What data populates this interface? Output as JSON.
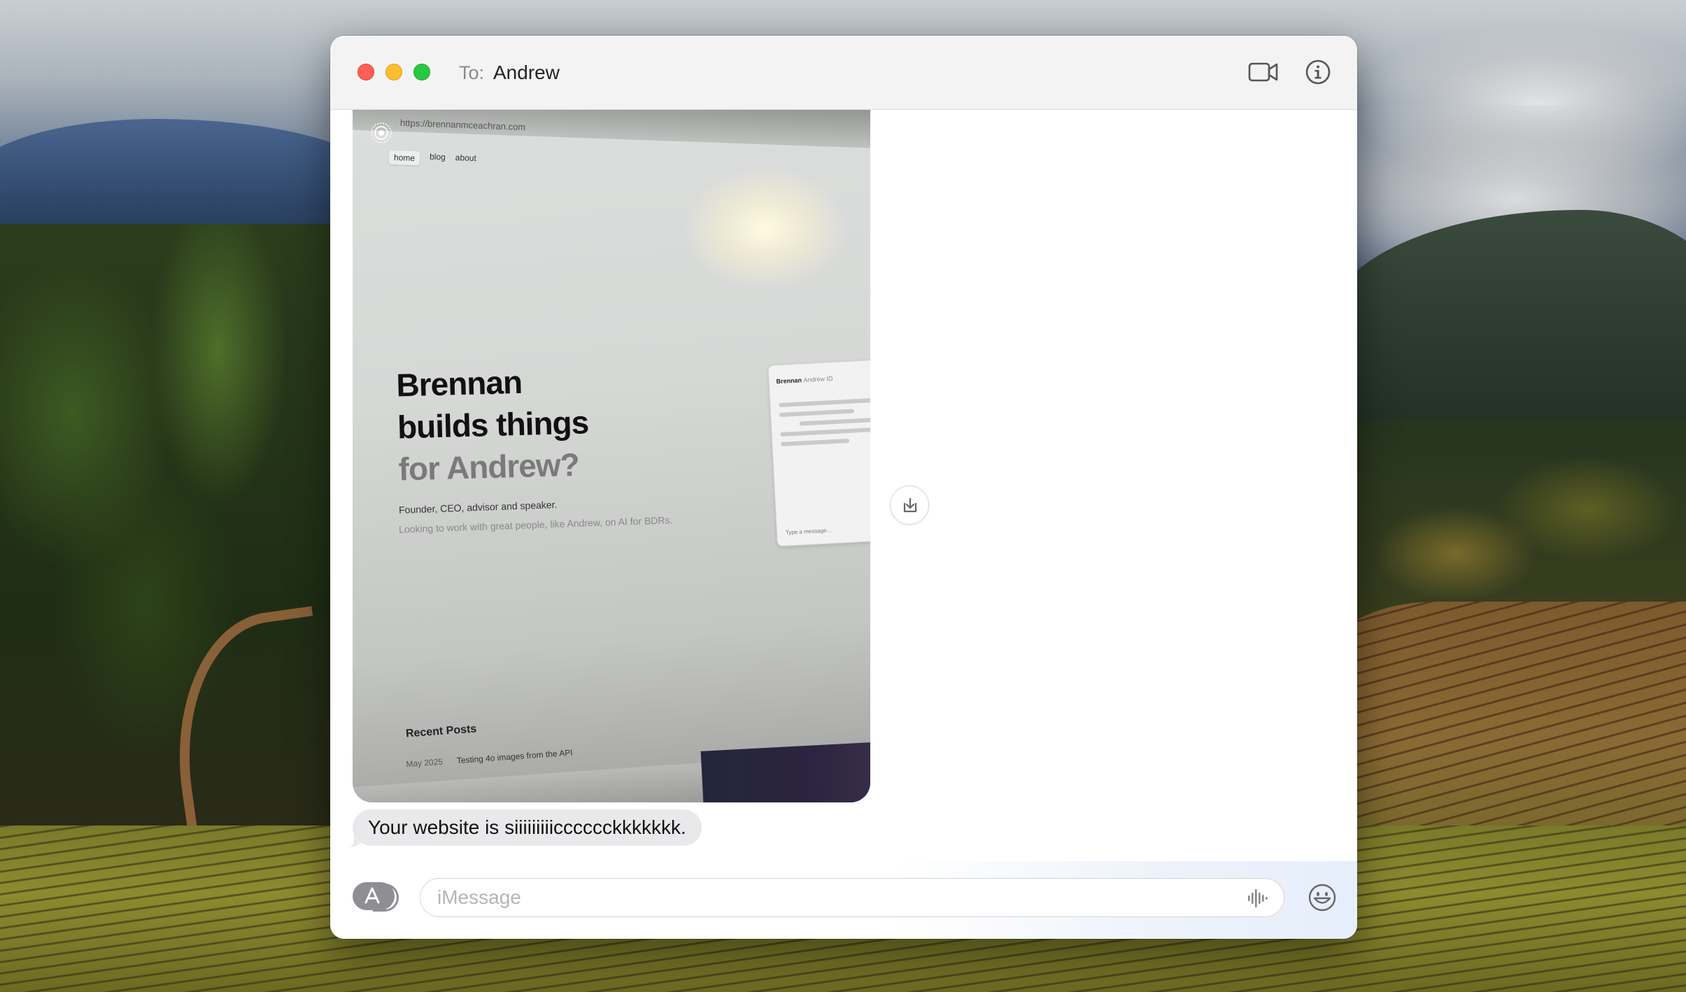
{
  "window": {
    "to_label": "To:",
    "recipient": "Andrew"
  },
  "attachment_photo": {
    "url": "https://brennanmceachran.com",
    "nav": [
      "home",
      "blog",
      "about"
    ],
    "hero_lines": [
      "Brennan",
      "builds things",
      "for Andrew?"
    ],
    "subtitle": "Founder, CEO, advisor and speaker.",
    "subtitle2": "Looking to work with great people, like Andrew, on AI for BDRs.",
    "chat_card_title": "Brennan",
    "chat_card_subtitle": "Andrew ID",
    "chat_card_input": "Type a message...",
    "recent_posts_heading": "Recent Posts",
    "post_date": "May 2025",
    "post_title": "Testing 4o images from the API"
  },
  "messages": [
    {
      "from": "Andrew",
      "text": "Your website is siiiiiiiiicccccckkkkkkk."
    }
  ],
  "compose": {
    "placeholder": "iMessage",
    "value": ""
  },
  "icons": {
    "facetime": "video-camera-icon",
    "info": "info-icon",
    "save": "save-to-downloads-icon",
    "apps": "app-store-icon",
    "audio": "audio-waveform-icon",
    "emoji": "emoji-icon",
    "live_photo": "live-photo-icon"
  },
  "colors": {
    "received_bubble": "#e9e9eb",
    "sent_bubble": "#1f7ff5",
    "close": "#fe5f57",
    "minimize": "#febc2e",
    "maximize": "#28c840"
  }
}
